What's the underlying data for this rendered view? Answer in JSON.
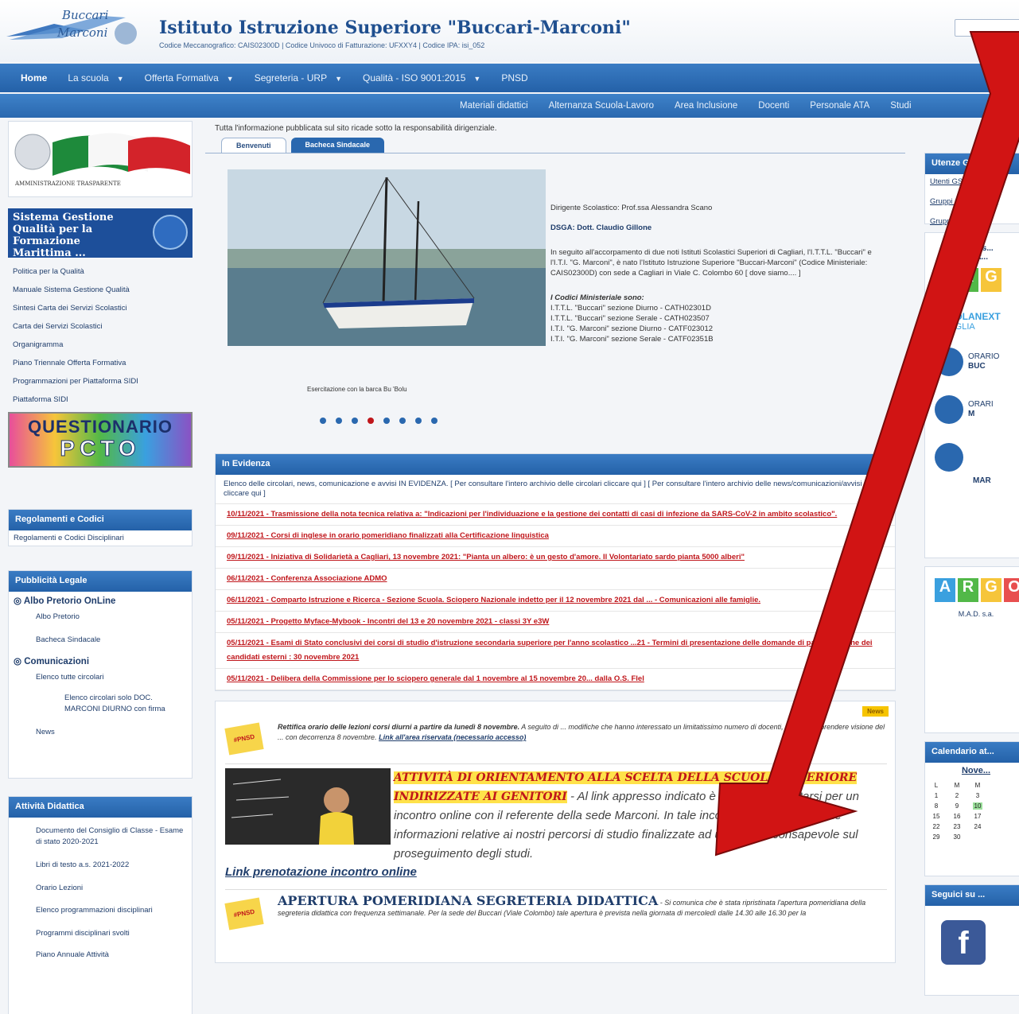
{
  "header": {
    "school_name": "Istituto Istruzione Superiore \"Buccari-Marconi\"",
    "codes_line": "Codice Meccanografico: CAIS02300D | Codice Univoco di Fatturazione: UFXXY4 | Codice IPA: isi_052",
    "logo_text_1": "Buccari",
    "logo_text_2": "Marconi"
  },
  "nav_main": [
    "Home",
    "La scuola",
    "Offerta Formativa",
    "Segreteria - URP",
    "Qualità - ISO 9001:2015",
    "PNSD"
  ],
  "nav_secondary": [
    "Materiali didattici",
    "Alternanza Scuola-Lavoro",
    "Area Inclusione",
    "Docenti",
    "Personale ATA",
    "Studi"
  ],
  "left": {
    "amministrazione_label": "AMMINISTRAZIONE TRASPARENTE",
    "sgq_title": "Sistema Gestione Qualità per la Formazione Marittima ...",
    "quality_links": [
      "Politica per la Qualità",
      "Manuale Sistema Gestione Qualità",
      "Sintesi Carta dei Servizi Scolastici",
      "Carta dei Servizi Scolastici",
      "Organigramma",
      "Piano Triennale Offerta Formativa",
      "Programmazioni per Piattaforma SIDI",
      "Piattaforma SIDI"
    ],
    "questionario_1": "QUESTIONARIO",
    "questionario_2": "PCTO",
    "regolamenti_title": "Regolamenti e Codici",
    "regolamenti_link": "Regolamenti e Codici Disciplinari",
    "pubblicita_title": "Pubblicità Legale",
    "albo_title": "Albo Pretorio OnLine",
    "albo_links": [
      "Albo Pretorio",
      "Bacheca Sindacale"
    ],
    "comunicazioni_title": "Comunicazioni",
    "comunicazioni_links": [
      "Elenco tutte circolari",
      "Elenco circolari solo DOC. MARCONI DIURNO con firma",
      "News"
    ],
    "attivita_title": "Attività Didattica",
    "attivita_links": [
      "Documento del Consiglio di Classe - Esame di stato 2020-2021",
      "Libri di testo a.s. 2021-2022",
      "Orario Lezioni",
      "Elenco programmazioni disciplinari",
      "Programmi disciplinari svolti",
      "Piano Annuale Attività"
    ]
  },
  "center": {
    "notice": "Tutta l'informazione pubblicata sul sito ricade sotto la responsabilità dirigenziale.",
    "tabs": [
      "Benvenuti",
      "Bacheca Sindacale"
    ],
    "caption": "Esercitazione con la barca Bu 'Bolu",
    "dirigente": "Dirigente Scolastico: Prof.ssa Alessandra Scano",
    "dsga": "DSGA: Dott. Claudio Gillone",
    "intro": "In seguito all'accorpamento di due noti Istituti Scolastici Superiori di Cagliari, l'I.T.T.L. \"Buccari\" e l'I.T.I. \"G. Marconi\", è nato l'Istituto Istruzione Superiore \"Buccari-Marconi\" (Codice Ministeriale: CAIS02300D) con sede a Cagliari in Viale C. Colombo 60 [ dove siamo.... ]",
    "codici_title": "I Codici Ministeriale sono:",
    "codici": [
      "I.T.T.L. \"Buccari\"  sezione Diurno - CATH02301D",
      "I.T.T.L. \"Buccari\"  sezione Serale - CATH023507",
      "I.T.I. \"G. Marconi\" sezione Diurno - CATF023012",
      "I.T.I. \"G. Marconi\" sezione Serale - CATF02351B"
    ],
    "evidenza_title": "In Evidenza",
    "evidenza_intro": "Elenco delle circolari, news, comunicazione e avvisi IN EVIDENZA. [ Per consultare l'intero archivio delle circolari cliccare qui ] [ Per consultare l'intero archivio delle news/comunicazioni/avvisi cliccare qui ]",
    "evidenza_items": [
      "10/11/2021 - Trasmissione della nota tecnica relativa a: \"Indicazioni per l'individuazione e la gestione dei contatti di casi di infezione da SARS-CoV-2 in ambito scolastico\".",
      "09/11/2021 - Corsi di inglese in orario pomeridiano finalizzati alla Certificazione linguistica",
      "09/11/2021 - Iniziativa di Solidarietà a Cagliari, 13 novembre 2021: \"Pianta un albero: è un gesto d'amore. Il Volontariato sardo pianta 5000 alberi\"",
      "06/11/2021 - Conferenza Associazione ADMO",
      "06/11/2021 - Comparto Istruzione e Ricerca - Sezione Scuola. Sciopero Nazionale indetto per il 12 novembre 2021 dal ... - Comunicazioni alle famiglie.",
      "05/11/2021 - Progetto Myface-Mybook - Incontri del 13 e 20 novembre 2021 - classi 3Y e3W",
      "05/11/2021 - Esami di Stato conclusivi dei corsi di studio d'istruzione secondaria superiore per l'anno scolastico ...21 - Termini di presentazione delle domande di partecipazione dei candidati esterni : 30 novembre 2021",
      "05/11/2021 - Delibera della Commissione per lo sciopero generale dal 1 novembre al 15 novembre 20... dalla O.S. Flel"
    ],
    "news_badge": "News",
    "news1_bold": "Rettifica orario delle lezioni corsi diurni a partire da lunedì 8 novembre.",
    "news1_rest": "A seguito di ... modifiche che hanno interessato un limitatissimo numero di docenti, si prega di prendere visione del ... con decorrenza 8 novembre.",
    "news1_link": "Link all'area riservata (necessario accesso)",
    "orientamento_title": "ATTIVITÀ DI ORIENTAMENTO ALLA SCELTA DELLA SCUOLA SUPERIORE INDIRIZZATE AI GENITORI",
    "orientamento_text": "- Al link appresso indicato è possibile prenotarsi per un incontro online con il referente della sede Marconi. In tale incontro verranno fornite le informazioni relative ai nostri percorsi di studio finalizzate ad una scelta consapevole sul proseguimento degli studi.",
    "orientamento_link": "Link prenotazione incontro online",
    "segreteria_title": "APERTURA POMERIDIANA SEGRETERIA DIDATTICA",
    "segreteria_text": "- Si comunica che è stata ripristinata l'apertura pomeridiana della segreteria didattica con frequenza settimanale. Per la sede del Buccari (Viale Colombo) tale apertura è prevista nella giornata di mercoledì dalle 14.30 alle 16.30 per la",
    "pnsd_icon": "#PNSD"
  },
  "right": {
    "utenze_title": "Utenze GSuite",
    "utenze_links": [
      "Utenti GSuite",
      "Gruppi Consigli di ...",
      "Gruppi Classe"
    ],
    "accesso_1": "Access...",
    "accesso_2": "Elett...",
    "argo_letters": [
      "A",
      "R",
      "G",
      "O"
    ],
    "scuolanext": "SCUOLANEXT",
    "famiglia": "FAMIGLIA",
    "orario_1": "ORARIO",
    "orario_1b": "BUC",
    "orario_2": "ORARI",
    "orario_2b": "M",
    "mar": "MAR",
    "mad": "M.A.D. s.a.",
    "calendario_title": "Calendario at...",
    "cal_month": "Nove...",
    "cal_days": [
      "L",
      "M",
      "M"
    ],
    "cal_rows": [
      [
        "1",
        "2",
        "3"
      ],
      [
        "8",
        "9",
        "10"
      ],
      [
        "15",
        "16",
        "17"
      ],
      [
        "22",
        "23",
        "24"
      ],
      [
        "29",
        "30",
        ""
      ]
    ],
    "seguici_title": "Seguici su ...",
    "facebook": "f"
  },
  "colors": {
    "nav_blue": "#2a68af",
    "evidence_red": "#c0161b",
    "highlight_yellow": "#ffe24a",
    "arrow_red": "#d11414"
  }
}
